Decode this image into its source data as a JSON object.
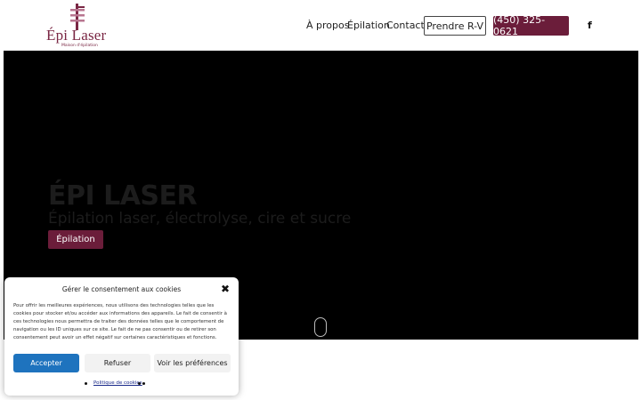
{
  "brand": {
    "name": "Épi Laser",
    "tagline": "Maison d'épilation"
  },
  "nav": {
    "items": [
      "À propos",
      "Épilation",
      "Contact"
    ],
    "cta_label": "Prendre R-V",
    "phone_label": "(450) 325-0621",
    "social_icon": "facebook-icon",
    "social_glyph": "f"
  },
  "hero": {
    "title": "ÉPI LASER",
    "subtitle": "Épilation laser, électrolyse, cire et sucre",
    "button_label": "Épilation"
  },
  "cookie": {
    "title": "Gérer le consentement aux cookies",
    "close_glyph": "✖",
    "body": "Pour offrir les meilleures expériences, nous utilisons des technologies telles que les cookies pour stocker et/ou accéder aux informations des appareils. Le fait de consentir à ces technologies nous permettra de traiter des données telles que le comportement de navigation ou les ID uniques sur ce site. Le fait de ne pas consentir ou de retirer son consentement peut avoir un effet négatif sur certaines caractéristiques et fonctions.",
    "accept_label": "Accepter",
    "refuse_label": "Refuser",
    "prefs_label": "Voir les préférences",
    "policy_label": "Politique de cookies"
  },
  "colors": {
    "brand": "#6b1d3a",
    "accept": "#1e73be",
    "hero_bg": "#000000"
  }
}
